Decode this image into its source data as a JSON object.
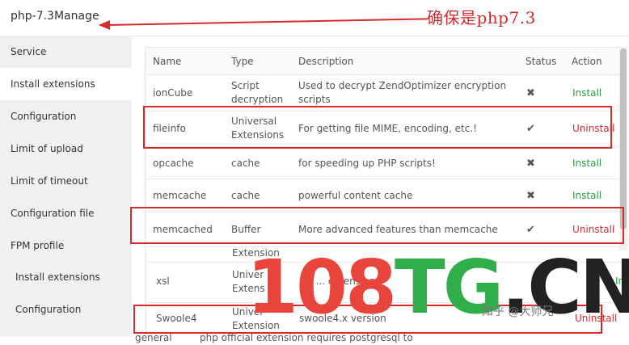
{
  "window": {
    "title": "php-7.3Manage"
  },
  "annotation": {
    "text": "确保是php7.3",
    "color": "#d42b2b"
  },
  "sidebar": {
    "items": [
      {
        "label": "Service",
        "active": false
      },
      {
        "label": "Install extensions",
        "active": true
      },
      {
        "label": "Configuration",
        "active": false
      },
      {
        "label": "Limit of upload",
        "active": false
      },
      {
        "label": "Limit of timeout",
        "active": false
      },
      {
        "label": "Configuration file",
        "active": false
      },
      {
        "label": "FPM profile",
        "active": false
      }
    ]
  },
  "table": {
    "columns": [
      "Name",
      "Type",
      "Description",
      "Status",
      "Action"
    ],
    "rows": [
      {
        "name": "ionCube",
        "type_line1": "Script",
        "type_line2": "decryption",
        "desc_line1": "Used to decrypt ZendOptimizer encryption",
        "desc_line2": "scripts",
        "status": "✖",
        "action": "Install"
      },
      {
        "name": "fileinfo",
        "type_line1": "Universal",
        "type_line2": "Extensions",
        "desc_line1": "For getting file MIME, encoding, etc.!",
        "desc_line2": "",
        "status": "✔",
        "action": "Uninstall"
      },
      {
        "name": "opcache",
        "type_line1": "cache",
        "type_line2": "",
        "desc_line1": "for speeding up PHP scripts!",
        "desc_line2": "",
        "status": "✖",
        "action": "Install"
      },
      {
        "name": "memcache",
        "type_line1": "cache",
        "type_line2": "",
        "desc_line1": "powerful content cache",
        "desc_line2": "",
        "status": "✖",
        "action": "Install"
      },
      {
        "name": "memcached",
        "type_line1": "Buffer",
        "type_line2": "",
        "desc_line1": "More advanced features than memcache",
        "desc_line2": "",
        "status": "✔",
        "action": "Uninstall"
      }
    ]
  },
  "lower": {
    "sidebar": [
      "Install extensions",
      "Configuration"
    ],
    "rows": [
      {
        "name": "",
        "type": "Extension",
        "desc": "",
        "action": ""
      },
      {
        "name": "xsl",
        "type": "Univer Extens",
        "desc": "xsl ... extension",
        "action": "Ins"
      },
      {
        "name": "Swoole4",
        "type": "Univer Extension",
        "desc": "swoole4.x version",
        "action": "Uninstall"
      },
      {
        "name": "",
        "type": "general",
        "desc": "php official extension requires postgresql to",
        "action": ""
      }
    ]
  },
  "watermark": {
    "part1": "108",
    "part2": "TG",
    "part3": ".CN",
    "small": "知乎 @大师兄"
  }
}
